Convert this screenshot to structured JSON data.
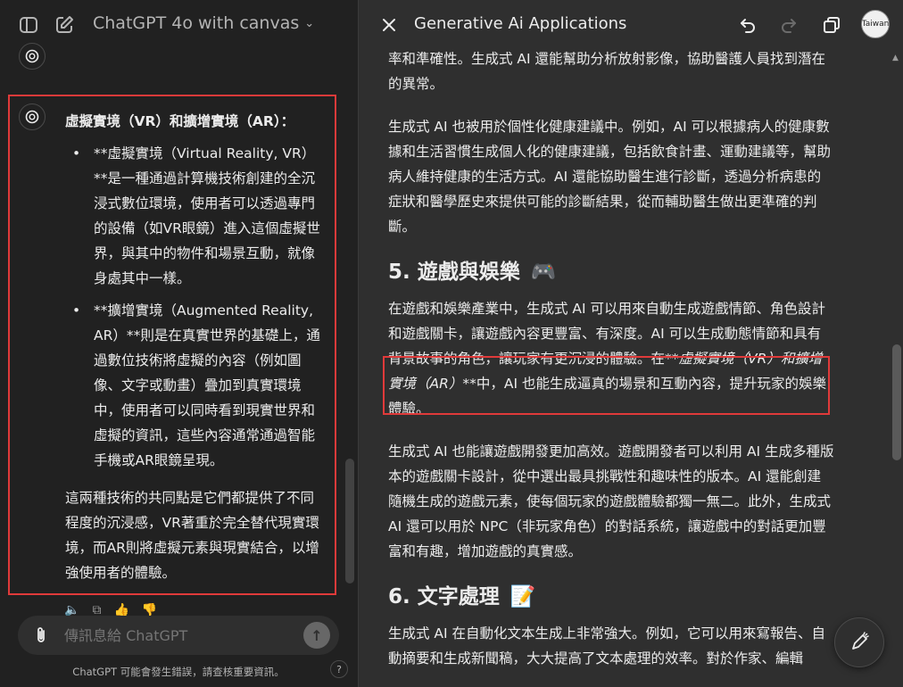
{
  "left": {
    "model_title": "ChatGPT 4o with canvas",
    "message": {
      "heading": "虛擬實境（VR）和擴增實境（AR）：",
      "bullets": [
        "**虛擬實境（Virtual Reality, VR）**是一種通過計算機技術創建的全沉浸式數位環境，使用者可以透過專門的設備（如VR眼鏡）進入這個虛擬世界，與其中的物件和場景互動，就像身處其中一樣。",
        "**擴增實境（Augmented Reality, AR）**則是在真實世界的基礎上，通過數位技術將虛擬的內容（例如圖像、文字或動畫）疊加到真實環境中，使用者可以同時看到現實世界和虛擬的資訊，這些內容通常通過智能手機或AR眼鏡呈現。"
      ],
      "paragraph": "這兩種技術的共同點是它們都提供了不同程度的沉浸感，VR著重於完全替代現實環境，而AR則將虛擬元素與現實結合，以增強使用者的體驗。"
    },
    "composer": {
      "placeholder": "傳訊息給 ChatGPT"
    },
    "disclaimer": "ChatGPT 可能會發生錯誤，請查核重要資訊。",
    "help": "?"
  },
  "right": {
    "doc_title": "Generative Ai Applications",
    "user_avatar_text": "Taiwan",
    "paragraphs_top": [
      "率和準確性。生成式 AI 還能幫助分析放射影像，協助醫護人員找到潛在的異常。",
      "生成式 AI 也被用於個性化健康建議中。例如，AI 可以根據病人的健康數據和生活習慣生成個人化的健康建議，包括飲食計畫、運動建議等，幫助病人維持健康的生活方式。AI 還能協助醫生進行診斷，透過分析病患的症狀和醫學歷史來提供可能的診斷結果，從而輔助醫生做出更準確的判斷。"
    ],
    "section5": {
      "title": "5. 遊戲與娛樂",
      "icon": "🎮",
      "p1_a": "在遊戲和娛樂產業中，生成式 AI 可以用來自動生成遊戲情節、角色設計和遊戲關卡，讓遊戲內容更豐富、有深度。AI 可以生成動態情節和具有背景故事的角色，讓玩家有更沉浸的體驗。在**",
      "p1_em": "虛擬實境（VR）和擴增實境（AR）",
      "p1_b": "**中，AI 也能生成逼真的場景和互動內容，提升玩家的娛樂體驗。",
      "p2": "生成式 AI 也能讓遊戲開發更加高效。遊戲開發者可以利用 AI 生成多種版本的遊戲關卡設計，從中選出最具挑戰性和趣味性的版本。AI 還能創建隨機生成的遊戲元素，使每個玩家的遊戲體驗都獨一無二。此外，生成式 AI 還可以用於 NPC（非玩家角色）的對話系統，讓遊戲中的對話更加豐富和有趣，增加遊戲的真實感。"
    },
    "section6": {
      "title": "6. 文字處理",
      "icon": "📝",
      "p1": "生成式 AI 在自動化文本生成上非常強大。例如，它可以用來寫報告、自動摘要和生成新聞稿，大大提高了文本處理的效率。對於作家、編輯"
    }
  }
}
